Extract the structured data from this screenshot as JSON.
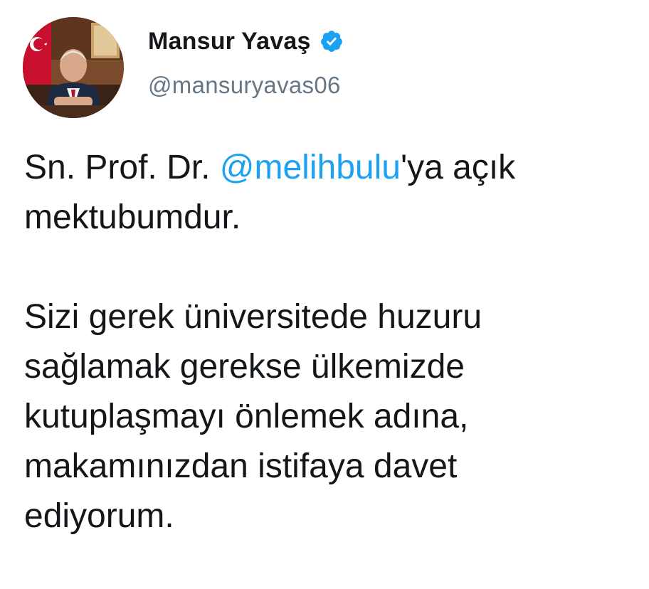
{
  "tweet": {
    "author": {
      "display_name": "Mansur Yavaş",
      "handle": "@mansuryavas06",
      "verified": true,
      "verified_icon": "verified-badge-icon",
      "verified_color": "#1da1f2"
    },
    "body": {
      "line1_prefix": "Sn. Prof. Dr. ",
      "mention": "@melihbulu",
      "line1_suffix": "'ya açık",
      "line2": "mektubumdur.",
      "paragraph2": [
        "Sizi gerek üniversitede huzuru",
        "sağlamak gerekse ülkemizde",
        "kutuplaşmayı önlemek adına,",
        "makamınızdan istifaya davet",
        "ediyorum."
      ]
    }
  },
  "colors": {
    "text": "#14171a",
    "secondary": "#657786",
    "link": "#1da1f2"
  }
}
